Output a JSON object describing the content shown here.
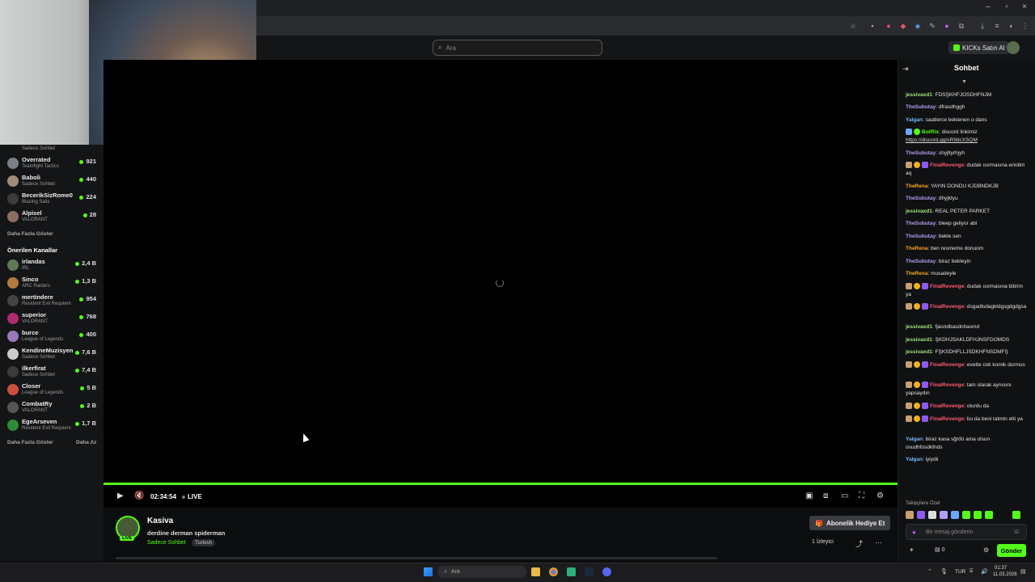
{
  "search": {
    "placeholder": "Ara"
  },
  "header": {
    "kicks_button": "KICKs Satın Al"
  },
  "sidebar": {
    "top_partial_category": "Sadece Sohbet",
    "followed": [
      {
        "name": "Overrated",
        "category": "Teamfight Tactics",
        "viewers": "921"
      },
      {
        "name": "Baboli",
        "category": "Sadece Sohbet",
        "viewers": "440"
      },
      {
        "name": "BecerikSizRome0",
        "category": "Blazing Sails",
        "viewers": "224"
      },
      {
        "name": "Alpisel",
        "category": "VALORANT",
        "viewers": "28"
      }
    ],
    "show_more_1": "Daha Fazla Göster",
    "recommended_title": "Önerilen Kanallar",
    "recommended": [
      {
        "name": "irlandas",
        "category": "IRL",
        "viewers": "2,4 B"
      },
      {
        "name": "Sinco",
        "category": "ARC Raiders",
        "viewers": "1,3 B"
      },
      {
        "name": "mertindere",
        "category": "Resident Evil Requiem",
        "viewers": "954"
      },
      {
        "name": "superior",
        "category": "VALORANT",
        "viewers": "768"
      },
      {
        "name": "burce",
        "category": "League of Legends",
        "viewers": "400"
      },
      {
        "name": "KendineMuzisyen",
        "category": "Sadece Sohbet",
        "viewers": "7,6 B"
      },
      {
        "name": "ilkerfirat",
        "category": "Sadece Sohbet",
        "viewers": "7,4 B"
      },
      {
        "name": "Closer",
        "category": "League of Legends",
        "viewers": "5 B"
      },
      {
        "name": "CombatRy",
        "category": "VALORANT",
        "viewers": "2 B"
      },
      {
        "name": "EgeArseven",
        "category": "Resident Evil Requiem",
        "viewers": "1,7 B"
      }
    ],
    "show_more_2": "Daha Fazla Göster",
    "show_less": "Daha Az"
  },
  "player": {
    "time": "02:34:54",
    "live": "LIVE"
  },
  "stream": {
    "streamer": "Kasiva",
    "title": "derdine derman spiderman",
    "category": "Sadece Sohbet",
    "language": "Turkish",
    "live_badge": "LIVE",
    "sub_gift_button": "Abonelik Hediye Et",
    "viewers_label": "1 İzleyici"
  },
  "chat": {
    "title": "Sohbet",
    "messages": [
      {
        "user": "jessivaxd1",
        "color": "#a0e37c",
        "text": "FDSŞKHFJOSDHFNJM"
      },
      {
        "user": "TheSubutay",
        "color": "#b49cf5",
        "text": "dfrasdhggh"
      },
      {
        "user": "Yalgan",
        "color": "#7cb8ff",
        "text": "saatlerce beklenen o dans"
      },
      {
        "user": "BotRix",
        "color": "#53fc18",
        "text": "discord linkimiz",
        "link": "https://discord.gg/sR9dcXSQM"
      },
      {
        "user": "TheSubutay",
        "color": "#b49cf5",
        "text": "shyjltyrhjyh"
      },
      {
        "user": "FinalRevenge",
        "color": "#ff5b6e",
        "text": "dudak ısırmasına erirdim aq"
      },
      {
        "user": "TheRena",
        "color": "#f5a623",
        "text": "YAYIN DONDU KJDBNDKJB"
      },
      {
        "user": "TheSubutay",
        "color": "#b49cf5",
        "text": "dhyjktyu"
      },
      {
        "user": "jessivaxd1",
        "color": "#a0e37c",
        "text": "REAL PETER PARKET"
      },
      {
        "user": "TheSubutay",
        "color": "#b49cf5",
        "text": "bleep geliyor abi"
      },
      {
        "user": "TheSubutay",
        "color": "#b49cf5",
        "text": "bekle sen"
      },
      {
        "user": "TheRena",
        "color": "#f5a623",
        "text": "ben resmeme donuom"
      },
      {
        "user": "TheSubutay",
        "color": "#b49cf5",
        "text": "biraz bekleyin"
      },
      {
        "user": "TheRena",
        "color": "#f5a623",
        "text": "musadeyle"
      },
      {
        "user": "FinalRevenge",
        "color": "#ff5b6e",
        "text": "dudak ısırmasına bitirim ya"
      },
      {
        "user": "FinalRevenge",
        "color": "#ff5b6e",
        "text": "dsgadlsdagkldgsgdgdgsa"
      },
      {
        "user": "jessivaxd1",
        "color": "#a0e37c",
        "text": "fjasndbasdnhasmd"
      },
      {
        "user": "jessivaxd1",
        "color": "#a0e37c",
        "text": "ŞKDHJSAKLDFHJNSFDOMDS"
      },
      {
        "user": "jessivaxd1",
        "color": "#a0e37c",
        "text": "FŞKSDHFLLJSDKHFNSDMFŞ"
      },
      {
        "user": "FinalRevenge",
        "color": "#ff5b6e",
        "text": "evette cok komik durmus"
      },
      {
        "user": "FinalRevenge",
        "color": "#ff5b6e",
        "text": "tam olarak aynısını yapsaydın"
      },
      {
        "user": "FinalRevenge",
        "color": "#ff5b6e",
        "text": "olurdu da"
      },
      {
        "user": "FinalRevenge",
        "color": "#ff5b6e",
        "text": "bu da beni tatmin etti ya"
      },
      {
        "user": "Yalgan",
        "color": "#7cb8ff",
        "text": "biraz kasa sğrdü ama olsun osudhfosdkfnds"
      },
      {
        "user": "Yalgan",
        "color": "#7cb8ff",
        "text": "iyiydii"
      }
    ],
    "followers_only": "Takipçilere Özel",
    "input_placeholder": "Bir mesaj gönderin",
    "gift_count": "0",
    "send_button": "Gönder"
  },
  "taskbar": {
    "search_placeholder": "Ara",
    "lang": "TUR",
    "time": "01:37",
    "date": "11.03.2026"
  }
}
